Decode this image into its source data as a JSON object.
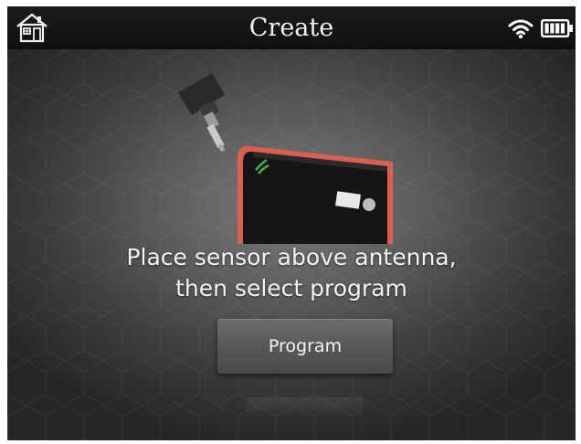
{
  "header": {
    "title": "Create",
    "home_icon": "home-icon",
    "wifi_icon": "wifi-icon",
    "battery_icon": "battery-icon",
    "battery_level": 1.0
  },
  "illustration": {
    "sensor_icon": "tpms-sensor",
    "device_icon": "tpms-tool-antenna"
  },
  "instruction": {
    "line1": "Place sensor above antenna,",
    "line2": "then select program"
  },
  "actions": {
    "program_label": "Program"
  },
  "colors": {
    "status_bar": "#141414",
    "screen_center": "#7a7a7a",
    "screen_edge": "#262626",
    "device_red": "#d9604f",
    "button": "#5a5a5a",
    "text": "#f4f4f4"
  }
}
